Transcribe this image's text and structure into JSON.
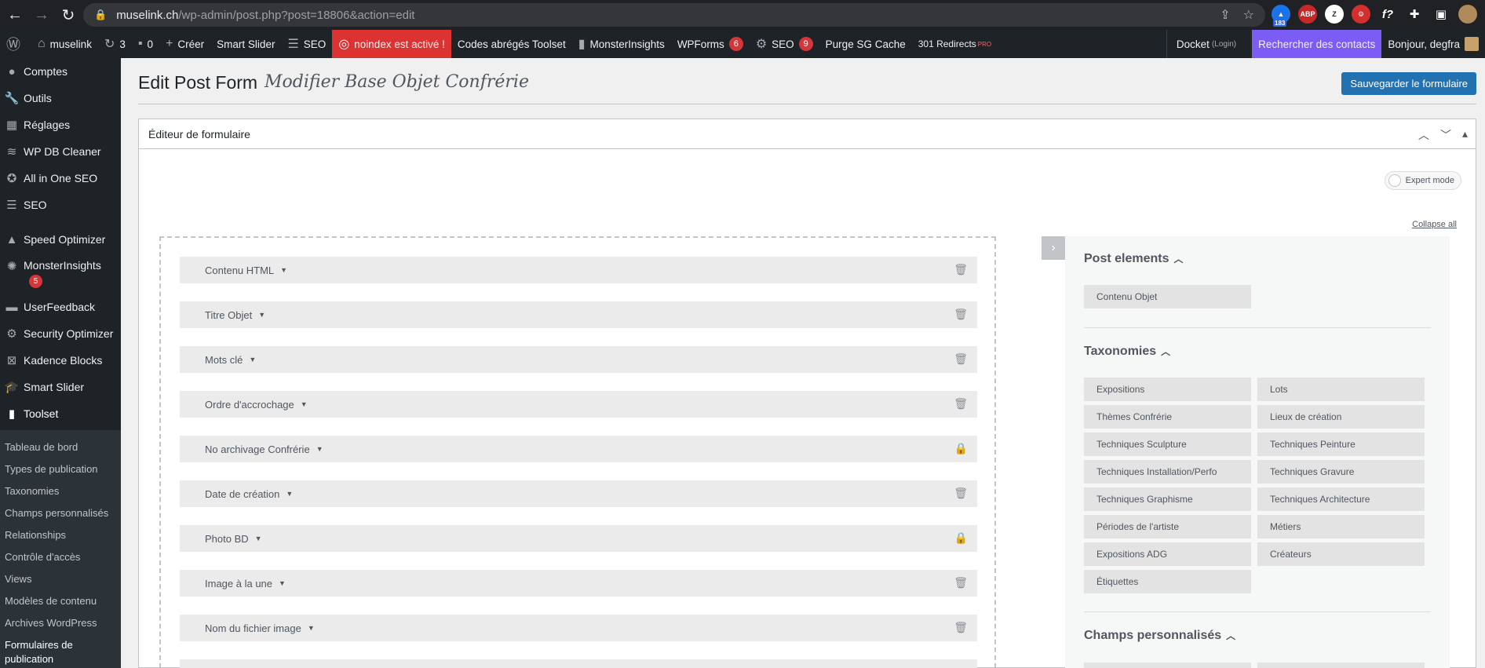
{
  "browser": {
    "url_host": "muselink.ch",
    "url_path": "/wp-admin/post.php?post=18806&action=edit",
    "ext_badge": "183"
  },
  "adminbar": {
    "site": "muselink",
    "updates": "3",
    "comments": "0",
    "create": "Créer",
    "smart_slider": "Smart Slider",
    "seo": "SEO",
    "noindex": "noindex est activé !",
    "toolset": "Codes abrégés Toolset",
    "monster": "MonsterInsights",
    "wpforms": "WPForms",
    "wpforms_count": "6",
    "seo2": "SEO",
    "seo2_count": "9",
    "purge": "Purge SG Cache",
    "redirects": "301 Redirects",
    "pro": "PRO",
    "docket": "Docket",
    "docket_login": "(Login)",
    "contacts": "Rechercher des contacts",
    "greeting": "Bonjour, degfra"
  },
  "sidebar": {
    "items": [
      {
        "label": "Comptes",
        "icon": "user-icon"
      },
      {
        "label": "Outils",
        "icon": "wrench-icon"
      },
      {
        "label": "Réglages",
        "icon": "settings-icon"
      },
      {
        "label": "WP DB Cleaner",
        "icon": "database-icon"
      },
      {
        "label": "All in One SEO",
        "icon": "aioseo-icon"
      },
      {
        "label": "SEO",
        "icon": "seo-icon"
      },
      {
        "label": "Speed Optimizer",
        "icon": "speed-icon"
      },
      {
        "label": "MonsterInsights",
        "icon": "monster-icon",
        "badge": "5"
      },
      {
        "label": "UserFeedback",
        "icon": "feedback-icon"
      },
      {
        "label": "Security Optimizer",
        "icon": "gear-icon"
      },
      {
        "label": "Kadence Blocks",
        "icon": "kadence-icon"
      },
      {
        "label": "Smart Slider",
        "icon": "graduation-icon"
      },
      {
        "label": "Toolset",
        "icon": "toolset-icon"
      }
    ],
    "submenu": [
      "Tableau de bord",
      "Types de publication",
      "Taxonomies",
      "Champs personnalisés",
      "Relationships",
      "Contrôle d'accès",
      "Views",
      "Modèles de contenu",
      "Archives WordPress",
      "Formulaires de publication"
    ]
  },
  "page": {
    "title": "Edit Post Form",
    "subtitle": "Modifier Base Objet Confrérie",
    "save": "Sauvegarder le formulaire"
  },
  "editor": {
    "header": "Éditeur de formulaire",
    "expert_mode": "Expert mode",
    "collapse_all": "Collapse all",
    "fields": [
      {
        "label": "Contenu HTML",
        "action": "trash"
      },
      {
        "label": "Titre Objet",
        "action": "trash"
      },
      {
        "label": "Mots clé",
        "action": "trash"
      },
      {
        "label": "Ordre d'accrochage",
        "action": "trash"
      },
      {
        "label": "No archivage Confrérie",
        "action": "lock"
      },
      {
        "label": "Date de création",
        "action": "trash"
      },
      {
        "label": "Photo BD",
        "action": "lock"
      },
      {
        "label": "Image à la une",
        "action": "trash"
      },
      {
        "label": "Nom du fichier image",
        "action": "trash"
      }
    ]
  },
  "panel": {
    "post_elements": "Post elements",
    "post_items": [
      "Contenu Objet"
    ],
    "taxonomies": "Taxonomies",
    "tax_items": [
      "Expositions",
      "Lots",
      "Thèmes Confrérie",
      "Lieux de création",
      "Techniques Sculpture",
      "Techniques Peinture",
      "Techniques Installation/Perfo",
      "Techniques Gravure",
      "Techniques Graphisme",
      "Techniques Architecture",
      "Périodes de l'artiste",
      "Métiers",
      "Expositions ADG",
      "Créateurs",
      "Étiquettes"
    ],
    "custom_fields": "Champs personnalisés"
  }
}
